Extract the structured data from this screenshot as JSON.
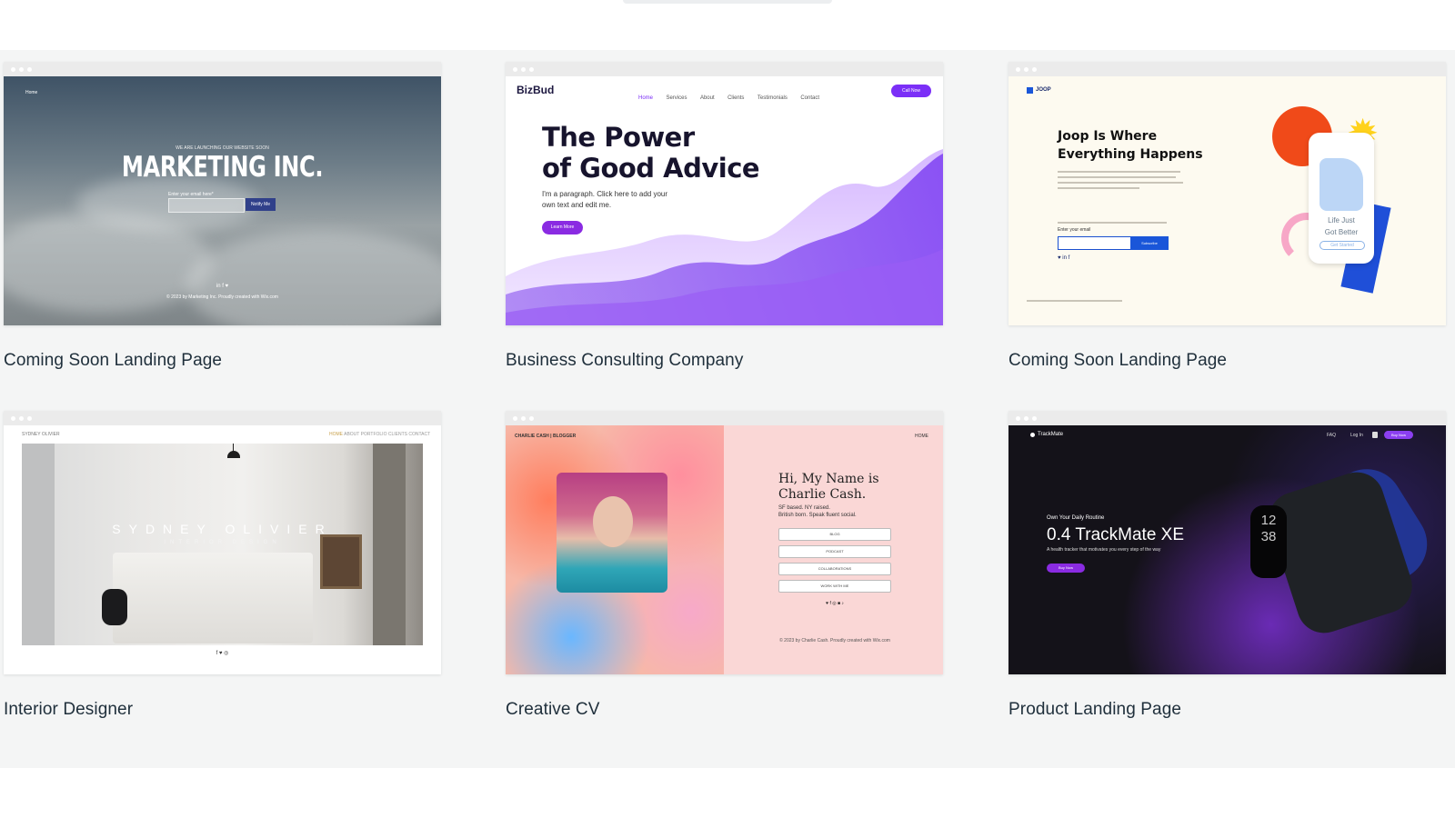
{
  "templates": [
    {
      "caption": "Coming Soon Landing Page",
      "preview": {
        "nav_home": "Home",
        "eyebrow": "WE ARE LAUNCHING OUR WEBSITE SOON",
        "title": "MARKETING INC.",
        "email_label": "Enter your email here*",
        "notify_button": "Notify Me",
        "social": "in   f   ♥",
        "footer": "© 2023 by Marketing Inc. Proudly created with Wix.com"
      }
    },
    {
      "caption": "Business Consulting Company",
      "preview": {
        "brand": "BizBud",
        "nav": [
          "Home",
          "Services",
          "About",
          "Clients",
          "Testimonials",
          "Contact"
        ],
        "cta": "Call Now",
        "headline_1": "The Power",
        "headline_2": "of Good Advice",
        "paragraph_1": "I'm a paragraph. Click here to add your",
        "paragraph_2": "own text and edit me.",
        "button": "Learn More"
      }
    },
    {
      "caption": "Coming Soon Landing Page",
      "preview": {
        "logo": "JOOP",
        "headline_1": "Joop Is Where",
        "headline_2": "Everything Happens",
        "email_label": "Enter your email",
        "subscribe": "Subscribe",
        "social": "♥  in  f",
        "phone_text_1": "Life Just",
        "phone_text_2": "Got Better",
        "phone_button": "Get Started"
      }
    },
    {
      "caption": "Interior Designer",
      "preview": {
        "brand": "SYDNEY OLIVIER",
        "nav": [
          "HOME",
          "ABOUT",
          "PORTFOLIO",
          "CLIENTS",
          "CONTACT"
        ],
        "name": "SYDNEY OLIVIER",
        "subtitle": "INTERIOR DESIGN",
        "social": "f ♥ ◎"
      }
    },
    {
      "caption": "Creative CV",
      "preview": {
        "brand": "CHARLIE CASH | BLOGGER",
        "nav_home": "HOME",
        "headline_1": "Hi, My Name is",
        "headline_2": "Charlie Cash.",
        "bio_1": "SF based. NY raised.",
        "bio_2": "British born. Speak fluent social.",
        "links": [
          "BLOG",
          "PODCAST",
          "COLLABORATIONS",
          "WORK WITH ME"
        ],
        "social": "♥ f ◎ ■ ♪",
        "footer": "© 2023 by Charlie Cash. Proudly created with Wix.com"
      }
    },
    {
      "caption": "Product Landing Page",
      "preview": {
        "brand": "TrackMate",
        "nav": [
          "FAQ",
          "Log In"
        ],
        "buy_button": "Buy Now",
        "eyebrow": "Own Your Daily Routine",
        "headline": "0.4 TrackMate XE",
        "paragraph": "A health tracker that motivates you every step of the way",
        "button": "Buy Now",
        "screen_time_1": "12",
        "screen_time_2": "38"
      }
    }
  ],
  "colors": {
    "background": "#f4f5f5",
    "caption_text": "#20303c",
    "bizbud_purple": "#7b2ff7",
    "joop_blue": "#1a56d9"
  }
}
